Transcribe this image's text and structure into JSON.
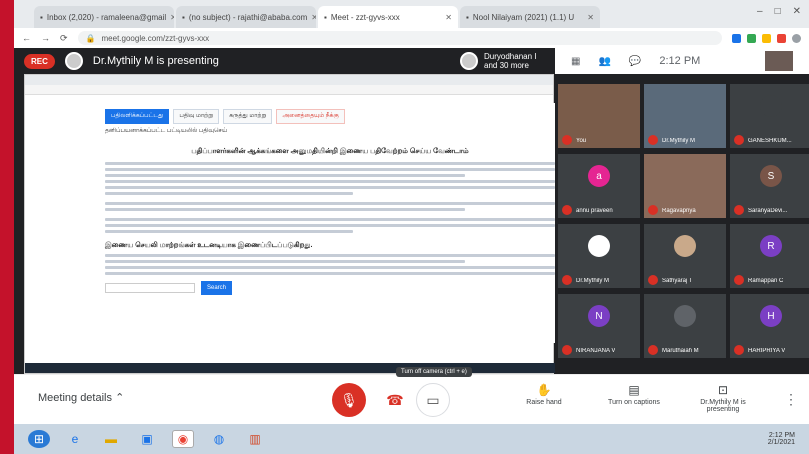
{
  "browser": {
    "tabs": [
      {
        "label": "Inbox (2,020) - ramaleena@gmail",
        "active": false
      },
      {
        "label": "(no subject) - rajathi@ababa.com",
        "active": false
      },
      {
        "label": "Meet - zzt-gyvs-xxx",
        "active": true
      },
      {
        "label": "Nool Nilaiyam (2021) (1.1) U",
        "active": false
      }
    ],
    "url": "meet.google.com/zzt-gyvs-xxx"
  },
  "presentation": {
    "rec_label": "REC",
    "presenter_text": "Dr.Mythily M is presenting",
    "others_text": "Duryodhanan I and 30 more",
    "time": "2:12 PM"
  },
  "document": {
    "buttons": [
      "பதிலளிக்கப்பட்டது",
      "பதிவு மாற்று",
      "கருத்து மாற்று",
      "அனைத்தையும் நீக்கு"
    ],
    "subtitle": "தனிப்பயனாக்கப்பட்ட பட்டியலில் பதிவுசெய்",
    "title": "பதிப்பாளர்களின் ஆக்கங்களை அனுமதியின்றி இணைய பதிவேற்றம் செய்ய வேண்டாம்",
    "section_title": "இணைய செயலி மாற்றங்கள் உடனடியாக இணைப்பிடப்படுகிறது.",
    "search_button": "Search"
  },
  "participants": [
    {
      "name": "You",
      "initial": "",
      "color": "#7a5c4a",
      "video": true
    },
    {
      "name": "Dr.Mythily M",
      "initial": "",
      "color": "#5a6a7a",
      "video": true
    },
    {
      "name": "GANESHKUM...",
      "initial": "",
      "color": "#3c4043",
      "video": false
    },
    {
      "name": "annu praveen",
      "initial": "a",
      "color": "#e52592",
      "video": false
    },
    {
      "name": "Ragavapriya",
      "initial": "",
      "color": "#8a6a5a",
      "video": true
    },
    {
      "name": "SaranyaDevi...",
      "initial": "S",
      "color": "#795548",
      "video": false
    },
    {
      "name": "Dr.Mythily M",
      "initial": "",
      "color": "#ffffff",
      "video": false
    },
    {
      "name": "Sathyaraj T",
      "initial": "",
      "color": "#c9a98a",
      "video": false
    },
    {
      "name": "Ramappan C",
      "initial": "R",
      "color": "#7b3fc4",
      "video": false
    },
    {
      "name": "NIRANJANA V",
      "initial": "N",
      "color": "#7b3fc4",
      "video": false
    },
    {
      "name": "Maruthaiah M",
      "initial": "",
      "color": "#5f6368",
      "video": false
    },
    {
      "name": "HARIPRIYA V",
      "initial": "H",
      "color": "#7b3fc4",
      "video": false
    }
  ],
  "controls": {
    "meeting_details": "Meeting details",
    "tooltip": "Turn off camera (ctrl + e)",
    "raise_hand": "Raise hand",
    "captions": "Turn on captions",
    "presenting": "Dr.Mythily M is presenting"
  },
  "taskbar": {
    "time": "2:12 PM",
    "date": "2/1/2021"
  },
  "colors": {
    "meet_bg": "#202124",
    "red": "#d93025",
    "blue": "#1a73e8"
  }
}
